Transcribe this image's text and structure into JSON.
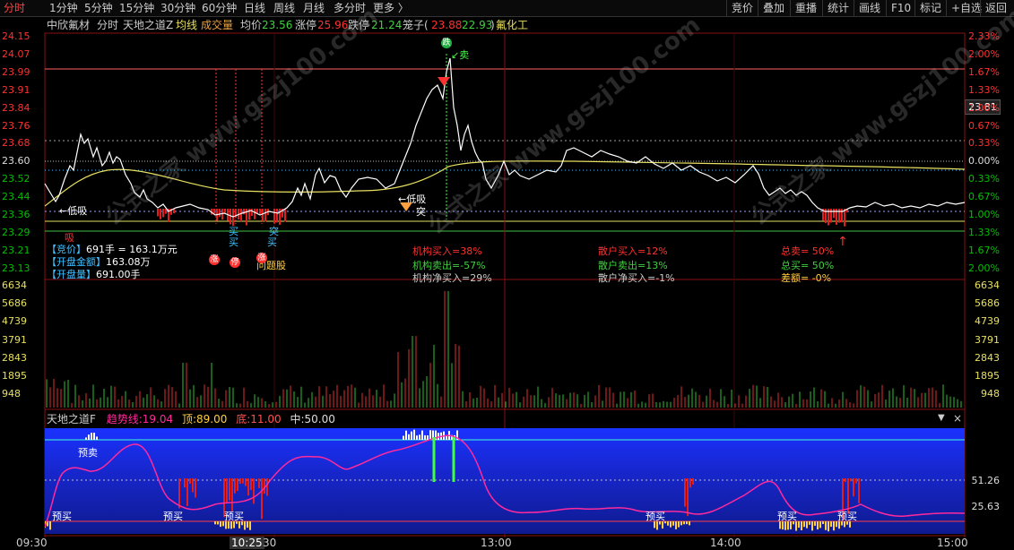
{
  "toolbar": {
    "periods": [
      "分时",
      "1分钟",
      "5分钟",
      "15分钟",
      "30分钟",
      "60分钟",
      "日线",
      "周线",
      "月线",
      "多分时",
      "更多 〉"
    ],
    "active_period": "分时",
    "right_buttons": [
      "竞价",
      "叠加",
      "重播",
      "统计",
      "画线",
      "F10",
      "标记",
      "+自选",
      "返回"
    ]
  },
  "info": {
    "stock_name": "中欣氟材",
    "mode": "分时",
    "formula": "天地之道Z",
    "avg_label": "均线",
    "vol_label": "成交量",
    "avg_price_label": "均价",
    "avg_price": "23.56",
    "limit_up_label": "涨停",
    "limit_up": "25.96",
    "limit_down_label": "跌停",
    "limit_down": "21.24",
    "cage_label": "笼子(",
    "cage_high": "23.88",
    "cage_low": "22.93",
    "cage_close": ")",
    "concept": "氟化工"
  },
  "price_axis": {
    "left": [
      "24.15",
      "24.07",
      "23.99",
      "23.91",
      "23.84",
      "23.76",
      "23.68",
      "23.60",
      "23.52",
      "23.44",
      "23.36",
      "23.29",
      "23.21",
      "23.13"
    ],
    "right": [
      "2.33%",
      "2.00%",
      "1.67%",
      "1.33%",
      "1.00%",
      "0.67%",
      "0.33%",
      "0.00%",
      "0.33%",
      "0.67%",
      "1.00%",
      "1.33%",
      "1.67%",
      "2.00%"
    ],
    "current_price_tag": "23.81"
  },
  "volume_axis": {
    "left": [
      "6634",
      "5686",
      "4739",
      "3791",
      "2843",
      "1895",
      "948"
    ],
    "right": [
      "6634",
      "5686",
      "4739",
      "3791",
      "2843",
      "1895",
      "948"
    ]
  },
  "auction": {
    "line1_label": "【竞价】",
    "line1_value": "691手 = 163.1万元",
    "line2_label": "【开盘金额】",
    "line2_value": "163.08万",
    "line3_label": "【开盘量】",
    "line3_value": "691.00手"
  },
  "stats": {
    "inst_buy": "机构买入=38%",
    "inst_sell": "机构卖出=-57%",
    "inst_net": "机构净买入=29%",
    "retail_buy": "散户买入=12%",
    "retail_sell": "散户卖出=13%",
    "retail_net": "散户净买入=-1%",
    "total_sell": "总卖= 50%",
    "total_buy": "总买= 50%",
    "diff": "差额= -0%"
  },
  "signals": {
    "low_buy": "←低吸",
    "low_buy2": "←低吸",
    "xi": "吸",
    "buy": "买",
    "sell": "卖",
    "tu": "突",
    "sell_arrow": "↙卖",
    "hot_stock": "问题股",
    "yuan": "低",
    "star_chars": [
      "涨",
      "停",
      "跌"
    ]
  },
  "indicator": {
    "title": "天地之道F",
    "trend_label": "趋势线:",
    "trend_value": "19.04",
    "top_label": "顶:",
    "top_value": "89.00",
    "bottom_label": "底:",
    "bottom_value": "11.00",
    "mid_label": "中:",
    "mid_value": "50.00",
    "right_levels": [
      "51.26",
      "25.63"
    ],
    "pre_buy": "预买",
    "pre_sell": "预卖"
  },
  "time_axis": {
    "labels": [
      "09:30",
      "10:25",
      "30",
      "13:00",
      "14:00",
      "15:00"
    ],
    "highlight": "10:25"
  },
  "watermark": "公式之家 www.gszj100.com",
  "colors": {
    "up": "#ff3030",
    "down": "#00c000",
    "price_line": "#ffffff",
    "avg_line": "#e8e060",
    "indicator_line": "#ff2a9c",
    "panel_bg": "#1a30ff"
  }
}
